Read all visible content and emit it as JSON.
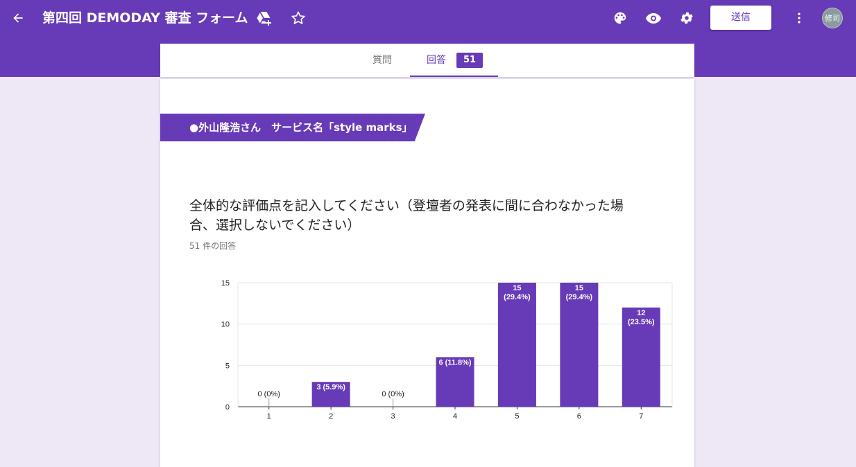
{
  "header": {
    "title": "第四回 DEMODAY 審査 フォーム",
    "send_label": "送信",
    "avatar_text": "修司",
    "colors": {
      "primary": "#673ab7",
      "background": "#ede7f6"
    }
  },
  "tabs": {
    "questions_label": "質問",
    "responses_label": "回答",
    "responses_count": "51"
  },
  "section": {
    "title": "●外山隆浩さん　サービス名「style marks」"
  },
  "question": {
    "text": "全体的な評価点を記入してください（登壇者の発表に間に合わなかった場合、選択しないでください）",
    "response_count": "51 件の回答"
  },
  "chart_data": {
    "type": "bar",
    "categories": [
      "1",
      "2",
      "3",
      "4",
      "5",
      "6",
      "7"
    ],
    "values": [
      0,
      3,
      0,
      6,
      15,
      15,
      12
    ],
    "data_labels": [
      "0 (0%)",
      "3 (5.9%)",
      "0 (0%)",
      "6 (11.8%)",
      "15\n(29.4%)",
      "15\n(29.4%)",
      "12\n(23.5%)"
    ],
    "ylim": [
      0,
      15
    ],
    "yticks": [
      0,
      5,
      10,
      15
    ],
    "grid": true,
    "bar_color": "#673ab7"
  }
}
